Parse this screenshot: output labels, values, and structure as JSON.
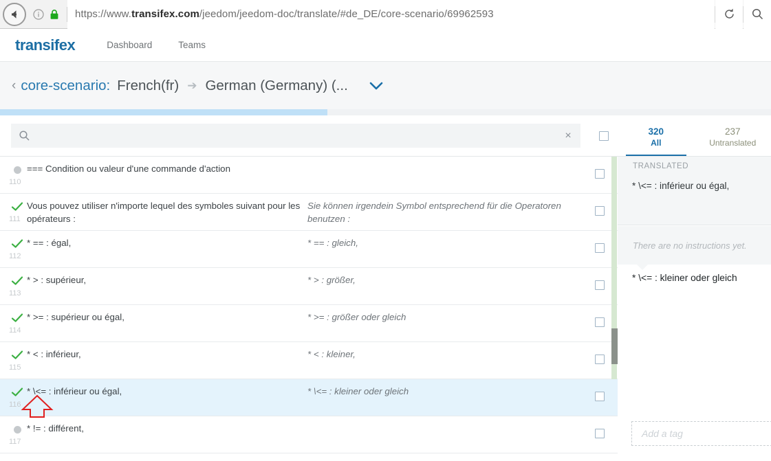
{
  "browser": {
    "back_icon": "back-arrow-icon",
    "info_icon": "info-icon",
    "lock_icon": "lock-icon",
    "url_protocol": "https://www.",
    "url_host_strong": "transifex.com",
    "url_path": "/jeedom/jeedom-doc/translate/#de_DE/core-scenario/69962593",
    "url_full": "https://www.transifex.com/jeedom/jeedom-doc/translate/#de_DE/core-scenario/69962593",
    "reload_icon": "reload-icon",
    "search_icon": "browser-search-icon"
  },
  "topnav": {
    "logo": "transifex",
    "links": [
      {
        "label": "Dashboard"
      },
      {
        "label": "Teams"
      }
    ]
  },
  "subheader": {
    "back_chevron": "‹",
    "project": "core-scenario:",
    "source_language": "French(fr)",
    "arrow": "➔",
    "target_language": "German (Germany) (...",
    "dropdown_icon": "chevron-down-icon"
  },
  "progress": {
    "percent": 42.5,
    "fill_color": "#bfe0f7",
    "track_color": "#f0f2f4"
  },
  "search": {
    "placeholder": "",
    "value": "",
    "icon": "search-icon",
    "clear_label": "×"
  },
  "tabs": [
    {
      "count": "320",
      "name": "All",
      "active": true
    },
    {
      "count": "237",
      "name": "Untranslated",
      "active": false
    }
  ],
  "rows": [
    {
      "number": "110",
      "status": "untranslated",
      "source": "=== Condition ou valeur d'une commande d'action",
      "target": "",
      "strip": "green",
      "selected": false
    },
    {
      "number": "111",
      "status": "translated",
      "source": "Vous pouvez utiliser n'importe lequel des symboles suivant pour les opérateurs :",
      "target": "Sie können irgendein Symbol entsprechend für die Operatoren benutzen :",
      "strip": "green",
      "selected": false
    },
    {
      "number": "112",
      "status": "translated",
      "source": "* == : égal,",
      "target": "* == : gleich,",
      "strip": "green",
      "selected": false
    },
    {
      "number": "113",
      "status": "translated",
      "source": "* > : supérieur,",
      "target": "* > : größer,",
      "strip": "green",
      "selected": false
    },
    {
      "number": "114",
      "status": "translated",
      "source": "* >= : supérieur ou égal,",
      "target": "* >= : größer oder gleich",
      "strip": "green",
      "selected": false
    },
    {
      "number": "115",
      "status": "translated",
      "source": "* < : inférieur,",
      "target": "* < : kleiner,",
      "strip": "green",
      "selected": false
    },
    {
      "number": "116",
      "status": "translated",
      "source": "* \\<= : inférieur ou égal,",
      "target": "* \\<= : kleiner oder gleich",
      "strip": "none",
      "selected": true
    },
    {
      "number": "117",
      "status": "untranslated",
      "source": "* != : différent,",
      "target": "",
      "strip": "none",
      "selected": false
    }
  ],
  "detail": {
    "status_label": "TRANSLATED",
    "source_text": "* \\<= : inférieur ou égal,",
    "instructions": "There are no instructions yet.",
    "target_text": "* \\<= : kleiner oder gleich",
    "tag_placeholder": "Add a tag"
  },
  "colors": {
    "brand_blue": "#1a6fa8",
    "link_blue": "#2a7ab0",
    "progress_blue": "#bfe0f7",
    "selected_row": "#e4f3fc",
    "status_green": "#3cb043",
    "strip_green": "#d6e8d1",
    "annotation_red": "#e02020"
  }
}
